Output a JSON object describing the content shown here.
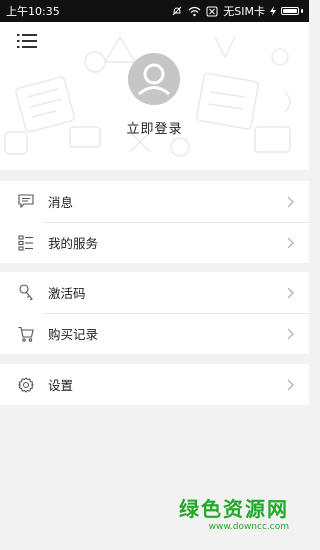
{
  "status": {
    "time": "上午10:35",
    "carrier": "无SIM卡",
    "battery": "charging"
  },
  "profile": {
    "login_label": "立即登录"
  },
  "menu": {
    "group1": [
      {
        "label": "消息",
        "icon": "message-icon"
      },
      {
        "label": "我的服务",
        "icon": "services-list-icon"
      }
    ],
    "group2": [
      {
        "label": "激活码",
        "icon": "key-icon"
      },
      {
        "label": "购买记录",
        "icon": "cart-icon"
      }
    ],
    "group3": [
      {
        "label": "设置",
        "icon": "gear-icon"
      }
    ]
  },
  "watermark": {
    "title": "绿色资源网",
    "url": "www.downcc.com"
  },
  "colors": {
    "accent_watermark": "#22a82a",
    "background": "#f2f2f2",
    "status_bar": "#111111"
  }
}
